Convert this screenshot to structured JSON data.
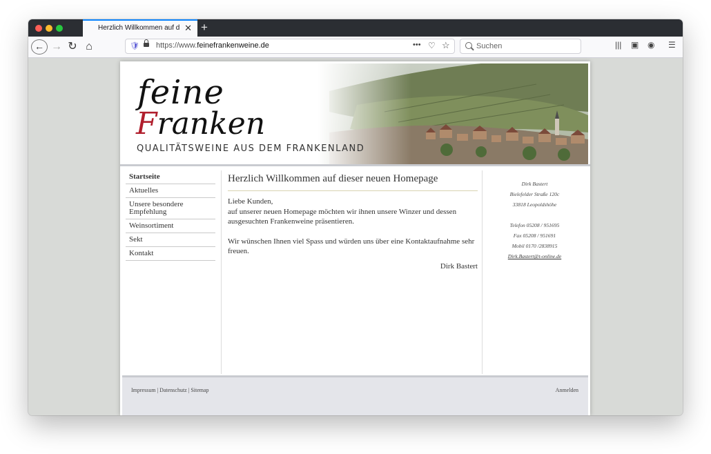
{
  "browser": {
    "tab_title": "Herzlich Willkommen auf dieser",
    "tab_close": "✕",
    "new_tab": "+",
    "url_prefix": "https://www.",
    "url_domain": "feinefrankenweine.de",
    "url_more": "•••",
    "search_placeholder": "Suchen",
    "back": "←",
    "forward": "→",
    "reload": "↻",
    "home": "⌂"
  },
  "header": {
    "logo_line1": "feine",
    "logo_f": "F",
    "logo_rest": "ranken",
    "tagline": "QUALITÄTSWEINE AUS DEM FRANKENLAND"
  },
  "nav": {
    "items": [
      {
        "label": "Startseite"
      },
      {
        "label": "Aktuelles"
      },
      {
        "label": "Unsere besondere Empfehlung"
      },
      {
        "label": "Weinsortiment"
      },
      {
        "label": "Sekt"
      },
      {
        "label": "Kontakt"
      }
    ]
  },
  "main": {
    "heading": "Herzlich Willkommen auf dieser neuen Homepage",
    "greeting": "Liebe Kunden,",
    "para1": "auf unserer neuen Homepage möchten wir ihnen unsere Winzer und dessen ausgesuchten Frankenweine präsentieren.",
    "para2": "Wir wünschen Ihnen viel Spass und würden uns über eine Kontaktaufnahme sehr freuen.",
    "signature": "Dirk Bastert"
  },
  "contact": {
    "name": "Dirk Bastert",
    "street": "Bielefelder Straße 120c",
    "city": "33818 Leopoldshöhe",
    "phone": "Telefon 05208 / 951695",
    "fax": "Fax 05208 / 951691",
    "mobile": "Mobil 0170 /2838915",
    "email": "Dirk.Bastert@t-online.de"
  },
  "footer": {
    "impressum": "Impressum",
    "datenschutz": "Datenschutz",
    "sitemap": "Sitemap",
    "separator": "|",
    "login": "Anmelden"
  },
  "colors": {
    "accent_red": "#b01e2c",
    "browser_tab_highlight": "#0a84ff"
  }
}
